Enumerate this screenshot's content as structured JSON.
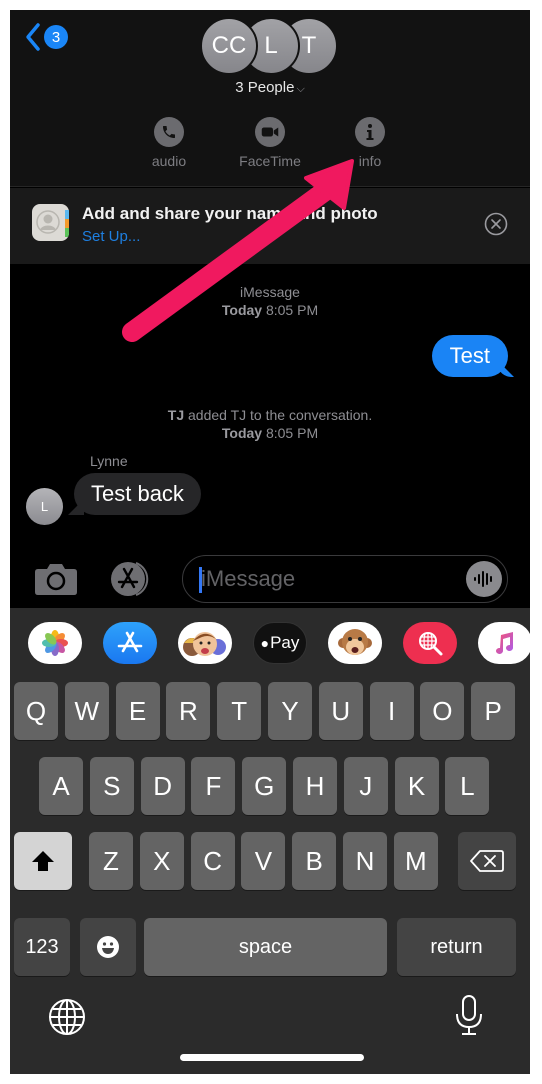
{
  "header": {
    "back_badge": "3",
    "avatars": [
      "CC",
      "L",
      "T"
    ],
    "group_name": "3 People",
    "actions": [
      {
        "icon": "phone-icon",
        "label": "audio"
      },
      {
        "icon": "video-icon",
        "label": "FaceTime"
      },
      {
        "icon": "info-icon",
        "label": "info"
      }
    ]
  },
  "banner": {
    "title": "Add and share your name and photo",
    "link": "Set Up..."
  },
  "conversation": {
    "service_label": "iMessage",
    "first_day": "Today",
    "first_time": "8:05 PM",
    "outgoing_message": "Test",
    "event_actor": "TJ",
    "event_text": "added TJ to the conversation.",
    "event_day": "Today",
    "event_time": "8:05 PM",
    "incoming_sender": "Lynne",
    "incoming_sender_initial": "L",
    "incoming_message": "Test back"
  },
  "composer": {
    "placeholder": "iMessage"
  },
  "app_strip": [
    {
      "name": "photos-app",
      "icon": "photos-icon"
    },
    {
      "name": "app-store-app",
      "icon": "app-store-icon"
    },
    {
      "name": "memoji-stickers-app",
      "icon": "memoji-icon"
    },
    {
      "name": "apple-pay-app",
      "label": "Pay",
      "icon": "apple-pay-icon"
    },
    {
      "name": "animoji-app",
      "icon": "monkey-icon"
    },
    {
      "name": "images-search-app",
      "icon": "globe-search-icon"
    },
    {
      "name": "music-app",
      "icon": "music-note-icon"
    }
  ],
  "keyboard": {
    "row1": [
      "Q",
      "W",
      "E",
      "R",
      "T",
      "Y",
      "U",
      "I",
      "O",
      "P"
    ],
    "row2": [
      "A",
      "S",
      "D",
      "F",
      "G",
      "H",
      "J",
      "K",
      "L"
    ],
    "row3": [
      "Z",
      "X",
      "C",
      "V",
      "B",
      "N",
      "M"
    ],
    "numbers_label": "123",
    "space_label": "space",
    "return_label": "return"
  },
  "annotation": {
    "arrow_color": "#f0195f",
    "points_to": "info"
  },
  "colors": {
    "accent_blue": "#1a84f5",
    "link_blue": "#1e7fe0"
  }
}
